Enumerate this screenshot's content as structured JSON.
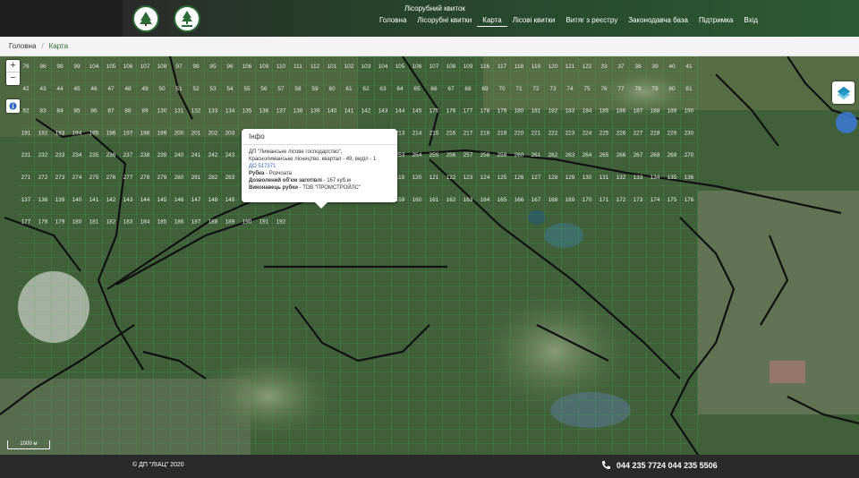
{
  "header": {
    "site_title": "Лісорубний квиток",
    "nav": [
      {
        "label": "Головна",
        "active": false
      },
      {
        "label": "Лісорубні квитки",
        "active": false
      },
      {
        "label": "Карта",
        "active": true
      },
      {
        "label": "Лісові квитки",
        "active": false
      },
      {
        "label": "Витяг з реєстру",
        "active": false
      },
      {
        "label": "Законодавча база",
        "active": false
      },
      {
        "label": "Підтримка",
        "active": false
      },
      {
        "label": "Вхід",
        "active": false
      }
    ]
  },
  "breadcrumb": {
    "home": "Головна",
    "separator": "/",
    "current": "Карта"
  },
  "map": {
    "zoom_in": "+",
    "zoom_out": "−",
    "scale_label": "1000 м",
    "icons": [
      "info-icon",
      "layers-icon"
    ],
    "popup": {
      "title": "Інфо",
      "line1": "ДП \"Лиманське лісове господарство\",",
      "line2": "Краснолиманське лісництво, квартал - 49, виділ - 1",
      "link": "ДО 517371",
      "cut_label": "Рубка",
      "cut_value": " - Розчоата",
      "volume_label": "Дозволений об'єм заготівлі",
      "volume_value": " - 167 куб.м",
      "executor_label": "Виконавець рубки",
      "executor_value": " - ТОВ \"ПРОМСТРОЙЛС\""
    },
    "grid_labels": [
      "76",
      "96",
      "98",
      "99",
      "104",
      "105",
      "106",
      "107",
      "108",
      "97",
      "98",
      "95",
      "96",
      "106",
      "109",
      "110",
      "111",
      "112",
      "101",
      "102",
      "103",
      "104",
      "105",
      "106",
      "107",
      "108",
      "109",
      "116",
      "117",
      "118",
      "119",
      "120",
      "121",
      "122",
      "33",
      "37",
      "38",
      "39",
      "40",
      "41",
      "42",
      "43",
      "44",
      "45",
      "46",
      "47",
      "48",
      "49",
      "50",
      "51",
      "52",
      "53",
      "54",
      "55",
      "56",
      "57",
      "58",
      "59",
      "60",
      "61",
      "62",
      "63",
      "64",
      "65",
      "66",
      "67",
      "68",
      "69",
      "70",
      "71",
      "72",
      "73",
      "74",
      "75",
      "76",
      "77",
      "78",
      "79",
      "80",
      "81",
      "82",
      "83",
      "84",
      "85",
      "86",
      "87",
      "88",
      "89",
      "130",
      "131",
      "132",
      "133",
      "134",
      "135",
      "136",
      "137",
      "138",
      "139",
      "140",
      "141",
      "142",
      "143",
      "144",
      "145",
      "175",
      "176",
      "177",
      "178",
      "179",
      "180",
      "181",
      "182",
      "183",
      "184",
      "185",
      "186",
      "187",
      "188",
      "189",
      "190",
      "191",
      "192",
      "193",
      "194",
      "195",
      "196",
      "197",
      "198",
      "199",
      "200",
      "201",
      "202",
      "203",
      "204",
      "205",
      "206",
      "207",
      "208",
      "209",
      "210",
      "211",
      "212",
      "213",
      "214",
      "215",
      "216",
      "217",
      "218",
      "219",
      "220",
      "221",
      "222",
      "223",
      "224",
      "225",
      "226",
      "227",
      "228",
      "229",
      "230",
      "231",
      "232",
      "233",
      "234",
      "235",
      "236",
      "237",
      "238",
      "239",
      "240",
      "241",
      "242",
      "243",
      "244",
      "245",
      "246",
      "247",
      "248",
      "249",
      "250",
      "251",
      "252",
      "253",
      "254",
      "255",
      "256",
      "257",
      "258",
      "259",
      "260",
      "261",
      "262",
      "263",
      "264",
      "265",
      "266",
      "267",
      "268",
      "269",
      "270",
      "271",
      "272",
      "273",
      "274",
      "275",
      "276",
      "277",
      "278",
      "279",
      "280",
      "281",
      "282",
      "283",
      "284",
      "285",
      "286",
      "113",
      "114",
      "115",
      "116",
      "117",
      "118",
      "119",
      "120",
      "121",
      "122",
      "123",
      "124",
      "125",
      "126",
      "127",
      "128",
      "129",
      "130",
      "131",
      "132",
      "133",
      "134",
      "135",
      "136",
      "137",
      "138",
      "139",
      "140",
      "141",
      "142",
      "143",
      "144",
      "145",
      "146",
      "147",
      "148",
      "149",
      "150",
      "151",
      "152",
      "153",
      "154",
      "155",
      "156",
      "157",
      "158",
      "159",
      "160",
      "161",
      "162",
      "163",
      "164",
      "165",
      "166",
      "167",
      "168",
      "169",
      "170",
      "171",
      "172",
      "173",
      "174",
      "175",
      "176",
      "177",
      "178",
      "179",
      "180",
      "181",
      "182",
      "183",
      "184",
      "185",
      "186",
      "187",
      "188",
      "189",
      "190",
      "191",
      "192"
    ]
  },
  "footer": {
    "copyright": "© ДП \"ЛІАЦ\" 2020",
    "phones": "044 235 7724  044 235 5506"
  },
  "colors": {
    "brand_green": "#2d6b36",
    "grid_green": "#3aa04a",
    "boundary": "#111111",
    "link_blue": "#2a66c4"
  }
}
